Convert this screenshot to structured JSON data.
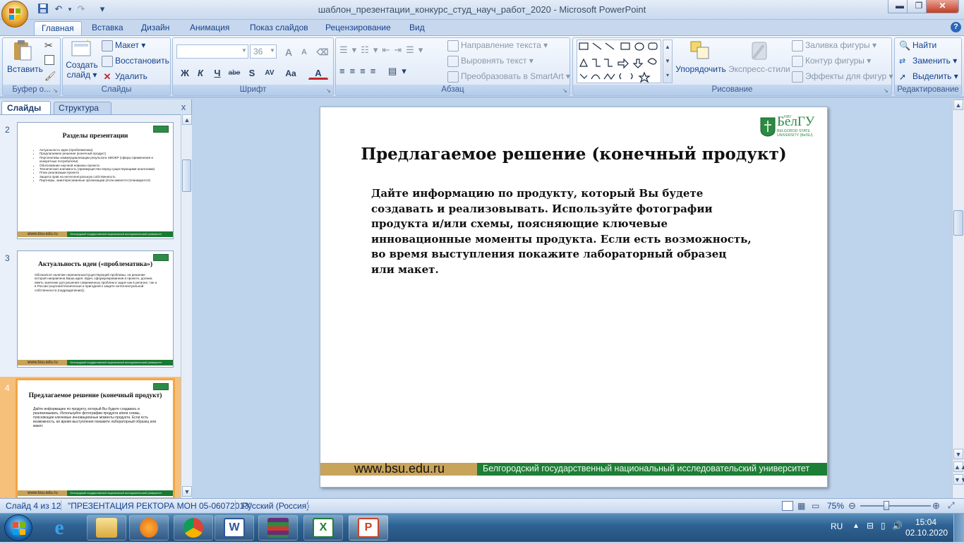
{
  "window": {
    "title": "шаблон_презентации_конкурс_студ_науч_работ_2020 - Microsoft PowerPoint",
    "qat": {
      "save": "save-icon",
      "undo": "undo-icon",
      "redo": "redo-icon",
      "customize": "▾"
    }
  },
  "tabs": [
    "Главная",
    "Вставка",
    "Дизайн",
    "Анимация",
    "Показ слайдов",
    "Рецензирование",
    "Вид"
  ],
  "ribbon": {
    "clipboard": {
      "paste": "Вставить",
      "label": "Буфер о..."
    },
    "slides": {
      "new_slide_line1": "Создать",
      "new_slide_line2": "слайд ▾",
      "layout": "Макет ▾",
      "reset": "Восстановить",
      "delete": "Удалить",
      "label": "Слайды"
    },
    "font": {
      "font_name": "",
      "font_size": "36",
      "bold": "Ж",
      "italic": "К",
      "underline": "Ч",
      "strike": "abe",
      "shadow": "S",
      "spacing": "AV",
      "case": "Aa",
      "color": "A",
      "grow": "A",
      "shrink": "A",
      "label": "Шрифт"
    },
    "paragraph": {
      "text_direction": "Направление текста ▾",
      "align_text": "Выровнять текст ▾",
      "smartart": "Преобразовать в SmartArt ▾",
      "label": "Абзац"
    },
    "drawing": {
      "arrange": "Упорядочить",
      "quick_styles": "Экспресс-стили",
      "fill": "Заливка фигуры ▾",
      "outline": "Контур фигуры ▾",
      "effects": "Эффекты для фигур ▾",
      "label": "Рисование"
    },
    "editing": {
      "find": "Найти",
      "replace": "Заменить ▾",
      "select": "Выделить ▾",
      "label": "Редактирование"
    }
  },
  "panel": {
    "tab_slides": "Слайды",
    "tab_outline": "Структура",
    "close": "x",
    "thumbnails": [
      {
        "num": "2",
        "title": "Разделы презентации",
        "items": [
          "Актуальность идеи (проблематика)",
          "Предлагаемое решение (конечный продукт)",
          "Перспективы коммерциализации результата НИОКР (сферы применения и конкретные потребители)",
          "Обоснование научной новизны проекта",
          "Техническая значимость (преимущества перед существующими аналогами)",
          "План реализации проекта",
          "Защита прав на интеллектуальную собственность",
          "Партнеры, заинтересованные организации (если имеются (планируются)"
        ]
      },
      {
        "num": "3",
        "title": "Актуальность идеи («проблематика»)",
        "text": "Обозначьте наличие нерешенных/существующей проблемы, на решение которой направлена Ваша идея. Идея, сформулированная в проекте, должна иметь значение для решения современных проблем и задач как в регионе, так и в России (научная/техническая и пригодной к защите интеллектуальной собственности (подразделение))."
      },
      {
        "num": "4",
        "title": "Предлагаемое решение (конечный продукт)",
        "text": "Дайте информацию по продукту, который Вы будете создавать и реализовывать. Используйте фотографии продукта и/или схемы, поясняющие ключевые инновационные моменты продукта. Если есть возможность, во время выступления покажите лабораторный образец или макет."
      }
    ],
    "footer_url": "www.bsu.edu.ru",
    "footer_uni": "Белгородский государственный национальный исследовательский университет"
  },
  "slide": {
    "logo_text": "БелГУ",
    "logo_sub1": "BELGOROD STATE",
    "logo_sub2": "UNIVERSITY (BelSU)",
    "logo_niu": "НИУ",
    "title": "Предлагаемое решение (конечный продукт)",
    "body": "Дайте информацию по продукту, который Вы будете создавать и реализовывать. Используйте фотографии продукта и/или схемы, поясняющие ключевые инновационные моменты продукта.  Если есть возможность, во время выступления покажите лабораторный образец или макет.",
    "footer_url": "www.bsu.edu.ru",
    "footer_uni": "Белгородский государственный национальный исследовательский университет"
  },
  "status": {
    "slide_counter": "Слайд 4 из 12",
    "theme": "\"ПРЕЗЕНТАЦИЯ РЕКТОРА МОН 05-06072013\"",
    "language": "Русский (Россия)",
    "zoom": "75%"
  },
  "taskbar": {
    "lang": "RU",
    "time": "15:04",
    "date": "02.10.2020",
    "apps": [
      "ie-icon",
      "explorer-icon",
      "media-player-icon",
      "chrome-icon",
      "word-icon",
      "winrar-icon",
      "excel-icon",
      "powerpoint-icon"
    ]
  },
  "colors": {
    "ribbon": "#dde8f6",
    "slide_footer_green": "#1d7f36",
    "slide_footer_gold": "#c8a35a",
    "selection": "#f4a543"
  }
}
